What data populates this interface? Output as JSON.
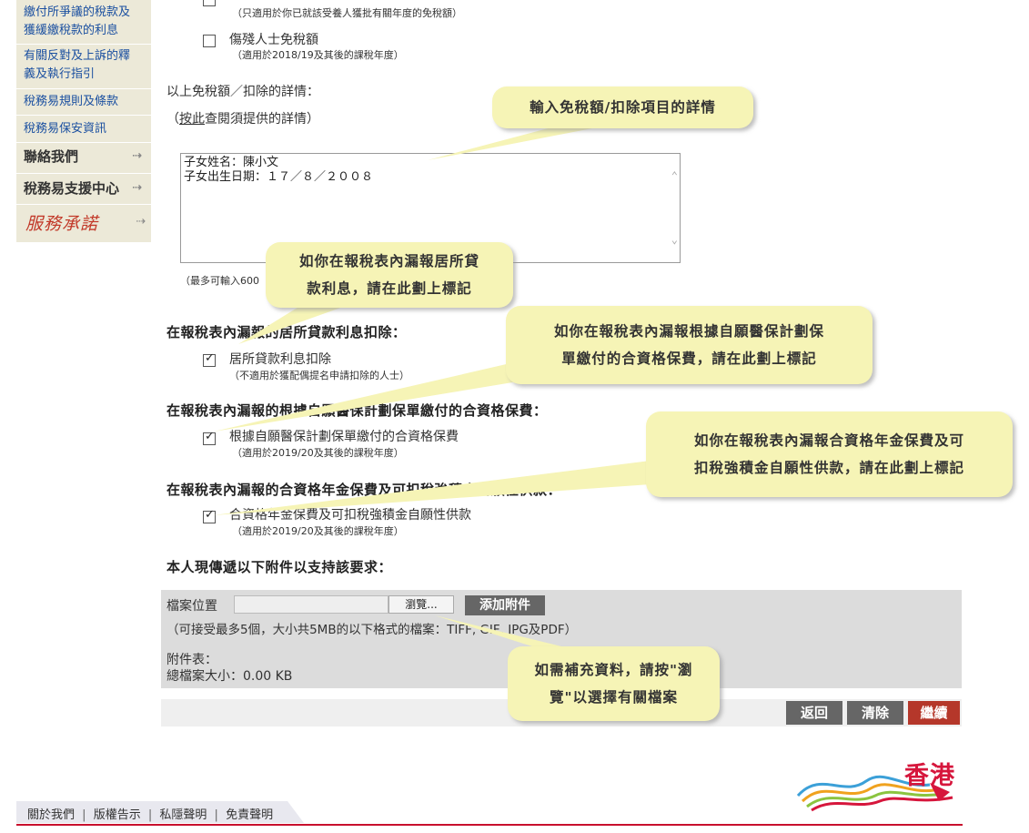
{
  "sidebar": {
    "links": [
      "繳付所爭議的稅款及",
      "獲緩繳稅款的利息",
      "有關反對及上訴的釋",
      "義及執行指引",
      "稅務易規則及條款",
      "稅務易保安資訊"
    ],
    "contact": "聯絡我們",
    "support": "稅務易支援中心",
    "service": "服務承諾"
  },
  "top": {
    "dependent_note": "（只適用於你已就該受養人獲批有關年度的免稅額）",
    "disabled_label": "傷殘人士免稅額",
    "disabled_note": "（適用於2018/19及其後的課稅年度）"
  },
  "details": {
    "title": "以上免稅額／扣除的詳情：",
    "paren_open": "（",
    "link_text": "按此",
    "link_rest": "查閱須提供的詳情）",
    "textarea_line1": "子女姓名：陳小文",
    "textarea_line2": "子女出生日期：１７／８／２００８",
    "limit_note": "（最多可輸入600"
  },
  "section_home_loan": {
    "heading": "在報稅表內漏報的居所貸款利息扣除：",
    "label": "居所貸款利息扣除",
    "note": "（不適用於獲配偶提名申請扣除的人士）",
    "checked": true
  },
  "section_vhis": {
    "heading": "在報稅表內漏報的根據自願醫保計劃保單繳付的合資格保費：",
    "label": "根據自願醫保計劃保單繳付的合資格保費",
    "note": "（適用於2019/20及其後的課稅年度）",
    "checked": true
  },
  "section_annuity": {
    "heading": "在報稅表內漏報的合資格年金保費及可扣稅強積金自願性供款：",
    "label": "合資格年金保費及可扣稅強積金自願性供款",
    "note": "（適用於2019/20及其後的課稅年度）",
    "checked": true
  },
  "attachments": {
    "heading": "本人現傳遞以下附件以支持該要求：",
    "file_location": "檔案位置",
    "browse": "瀏覽...",
    "add": "添加附件",
    "accept_note": "（可接受最多5個，大小共5MB的以下格式的檔案：TIFF, GIF, JPG及PDF）",
    "list_label": "附件表：",
    "total_size": "總檔案大小：0.00 KB"
  },
  "buttons": {
    "back": "返回",
    "clear": "清除",
    "continue": "繼續"
  },
  "callouts": {
    "details": "輸入免稅額/扣除項目的詳情",
    "home_loan_1": "如你在報稅表內漏報居所貸",
    "home_loan_2": "款利息，請在此劃上標記",
    "vhis_1": "如你在報稅表內漏報根據自願醫保計劃保",
    "vhis_2": "單繳付的合資格保費，請在此劃上標記",
    "annuity_1": "如你在報稅表內漏報合資格年金保費及可",
    "annuity_2": "扣稅強積金自願性供款，請在此劃上標記",
    "browse_1": "如需補充資料，請按\"瀏",
    "browse_2": "覽\"以選擇有關檔案"
  },
  "footer": {
    "about": "關於我們",
    "copyright": "版權告示",
    "privacy": "私隱聲明",
    "disclaimer": "免責聲明",
    "sep": "|"
  },
  "brand": {
    "hk": "香港"
  },
  "colors": {
    "sidebar_bg": "#ece9d8",
    "callout_bg": "#f6f4b6",
    "continue_btn": "#b5372a",
    "footer_line": "#c8102e"
  }
}
